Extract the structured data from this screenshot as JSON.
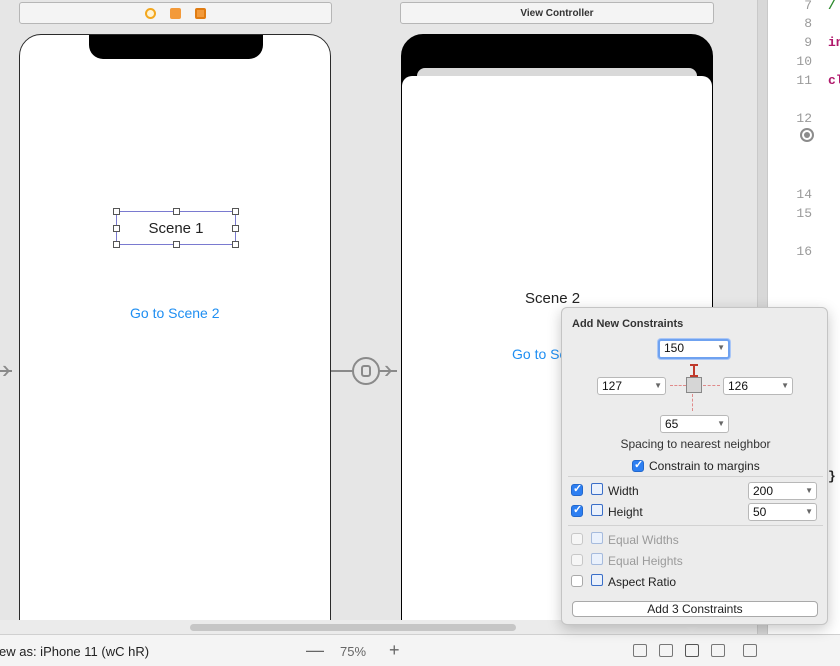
{
  "canvas": {
    "left_scene": {
      "label": "Scene 1",
      "link": "Go to Scene 2"
    },
    "right_scene": {
      "dock_title": "View Controller",
      "label": "Scene 2",
      "link": "Go to Sc"
    }
  },
  "editor": {
    "lines": [
      {
        "n": "7",
        "code": "/"
      },
      {
        "n": "8",
        "code": ""
      },
      {
        "n": "9",
        "code": "in"
      },
      {
        "n": "10",
        "code": ""
      },
      {
        "n": "11",
        "code": "cl"
      },
      {
        "n": "12",
        "code": ""
      },
      {
        "n": "14",
        "code": ""
      },
      {
        "n": "15",
        "code": ""
      },
      {
        "n": "16",
        "code": ""
      }
    ],
    "closing_brace": "}"
  },
  "bottombar": {
    "view_as": "ew as: iPhone 11 (wC hR)",
    "zoom_minus": "—",
    "zoom_level": "75%",
    "zoom_plus": "+"
  },
  "popover": {
    "title": "Add New Constraints",
    "top": "150",
    "left": "127",
    "right": "126",
    "bottom": "65",
    "spacing_label": "Spacing to nearest neighbor",
    "constrain_margins": "Constrain to margins",
    "width_label": "Width",
    "width_value": "200",
    "height_label": "Height",
    "height_value": "50",
    "equal_widths": "Equal Widths",
    "equal_heights": "Equal Heights",
    "aspect_ratio": "Aspect Ratio",
    "add_button": "Add 3 Constraints"
  },
  "colors": {
    "accent": "#2d7ff2",
    "link": "#1e8ef2",
    "constraint": "#c0392b"
  }
}
